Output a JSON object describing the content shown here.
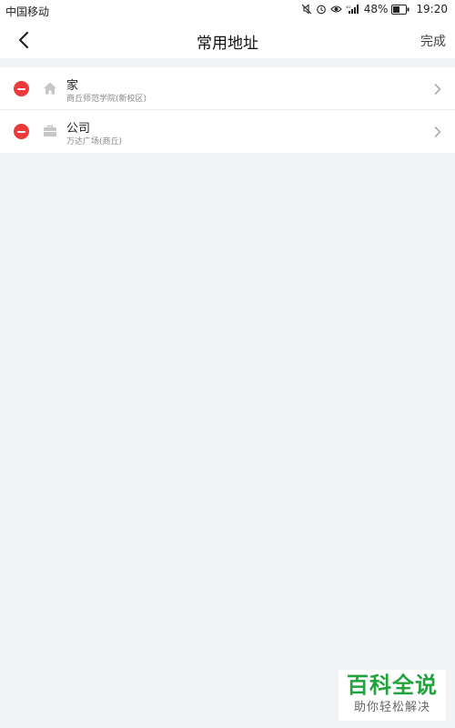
{
  "status_bar": {
    "carrier": "中国移动",
    "battery_percent": "48%",
    "time": "19:20",
    "icons": [
      "mute-icon",
      "alarm-icon",
      "eye-icon",
      "signal-icon",
      "battery-icon"
    ]
  },
  "nav": {
    "back_icon": "chevron-left-icon",
    "title": "常用地址",
    "done_label": "完成"
  },
  "addresses": [
    {
      "name": "家",
      "address": "商丘师范学院(新校区)",
      "icon": "home-icon"
    },
    {
      "name": "公司",
      "address": "万达广场(商丘)",
      "icon": "briefcase-icon"
    }
  ],
  "colors": {
    "delete": "#ec3a3a",
    "background": "#f2f3f5",
    "watermark_green": "#22a33d"
  },
  "watermark": {
    "top": "百科全说",
    "bottom": "助你轻松解决"
  }
}
